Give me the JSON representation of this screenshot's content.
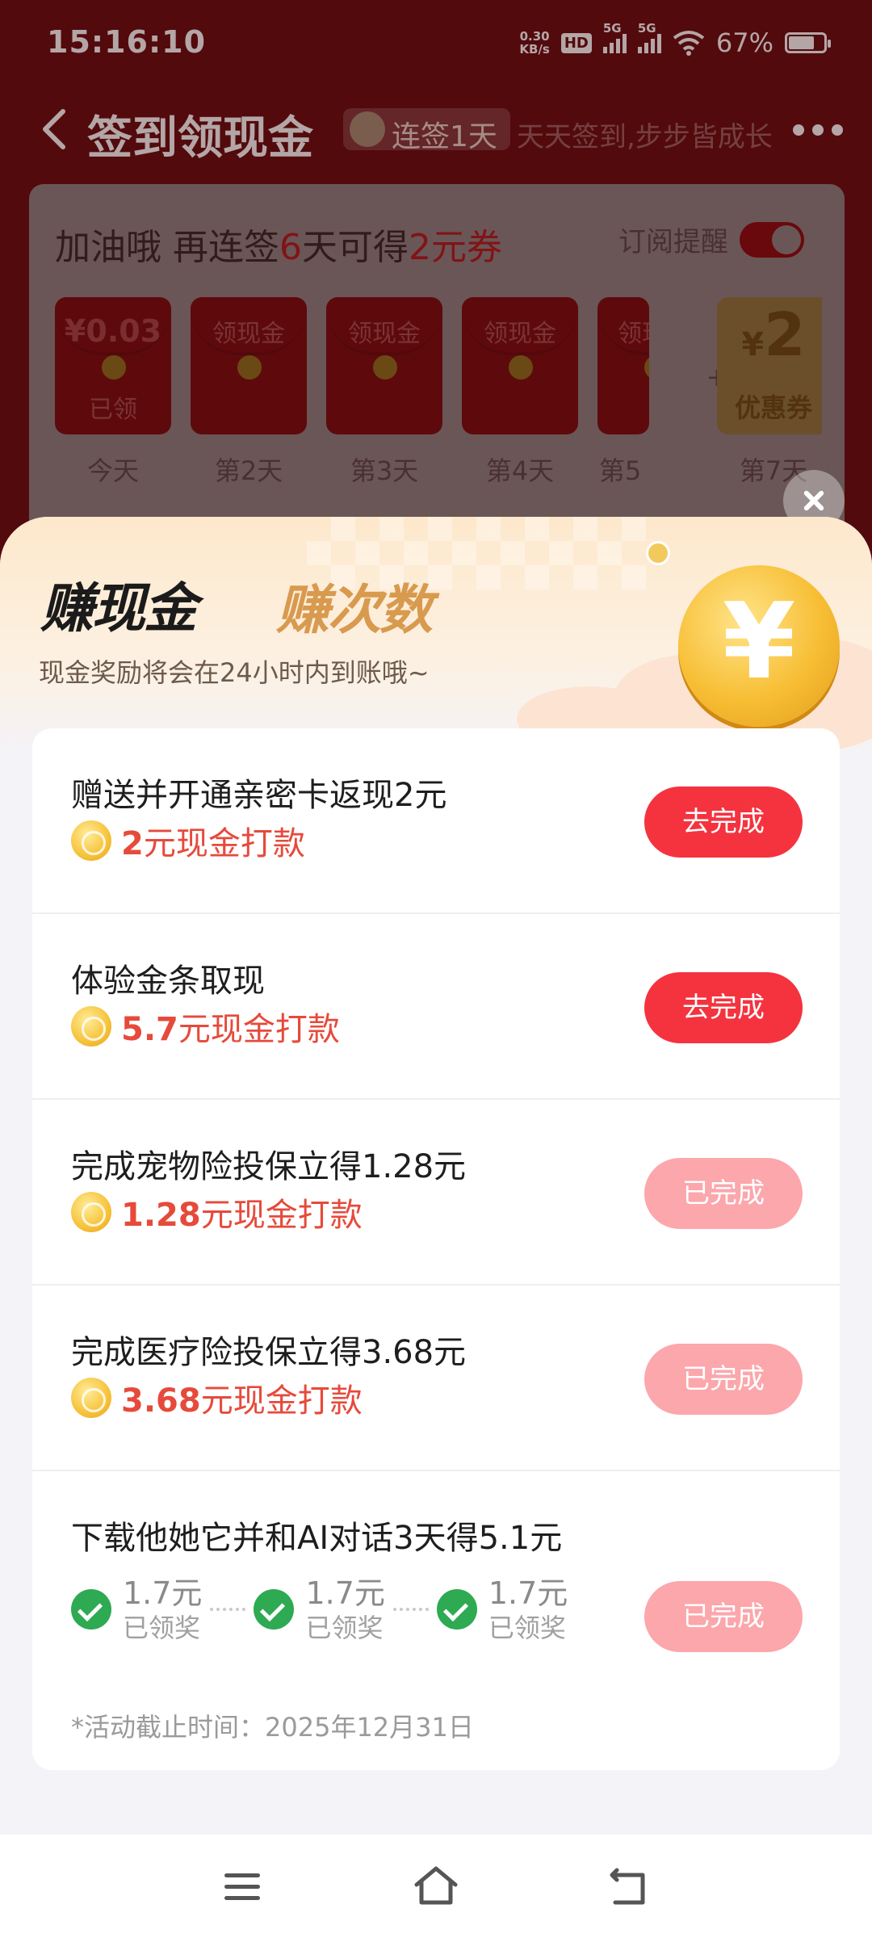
{
  "status_bar": {
    "time": "15:16:10",
    "net_speed_value": "0.30",
    "net_speed_unit": "KB/s",
    "hd_badge": "HD",
    "sim1": "5G",
    "sim2": "5G",
    "battery": "67%",
    "battery_level": 0.67
  },
  "nav": {
    "title": "签到领现金",
    "streak_badge": "连签1天",
    "slogan": "天天签到,步步皆成长"
  },
  "checkin": {
    "headline_parts": [
      "加油哦 再连签",
      "6",
      "天可得",
      "2元券"
    ],
    "subscribe_label": "订阅提醒",
    "subscribe_on": true,
    "days": [
      {
        "label": "¥0.03",
        "sub": "已领",
        "caption": "今天"
      },
      {
        "label": "领现金",
        "sub": "",
        "caption": "第2天"
      },
      {
        "label": "领现金",
        "sub": "",
        "caption": "第3天"
      },
      {
        "label": "领现金",
        "sub": "",
        "caption": "第4天"
      },
      {
        "label": "领现",
        "sub": "",
        "caption": "第5"
      }
    ],
    "day7": {
      "symbol": "¥",
      "amount": "2",
      "label": "优惠券",
      "caption": "第7天"
    }
  },
  "sheet": {
    "tab_active": "赚现金",
    "tab_inactive": "赚次数",
    "subtitle": "现金奖励将会在24小时内到账哦~",
    "coin_symbol": "¥"
  },
  "tasks": [
    {
      "title": "赠送并开通亲密卡返现2元",
      "amount": "2",
      "suffix": "元现金打款",
      "button": "去完成",
      "state": "todo"
    },
    {
      "title": "体验金条取现",
      "amount": "5.7",
      "suffix": "元现金打款",
      "button": "去完成",
      "state": "todo"
    },
    {
      "title": "完成宠物险投保立得1.28元",
      "amount": "1.28",
      "suffix": "元现金打款",
      "button": "已完成",
      "state": "done"
    },
    {
      "title": "完成医疗险投保立得3.68元",
      "amount": "3.68",
      "suffix": "元现金打款",
      "button": "已完成",
      "state": "done"
    }
  ],
  "ai_task": {
    "title": "下载他她它并和AI对话3天得5.1元",
    "steps": [
      {
        "value": "1.7元",
        "status": "已领奖"
      },
      {
        "value": "1.7元",
        "status": "已领奖"
      },
      {
        "value": "1.7元",
        "status": "已领奖"
      }
    ],
    "button": "已完成",
    "deadline": "*活动截止时间：2025年12月31日"
  },
  "colors": {
    "accent_red": "#f4333f",
    "done_pink": "#fba7ac",
    "reward_red": "#e64a3b",
    "success_green": "#2eaa52"
  },
  "icons": {
    "back": "back-icon",
    "more": "more-icon",
    "close": "close-icon",
    "coin": "coin-icon",
    "check": "check-icon",
    "menu": "menu-icon",
    "home": "home-icon",
    "sys_back": "back-icon"
  }
}
